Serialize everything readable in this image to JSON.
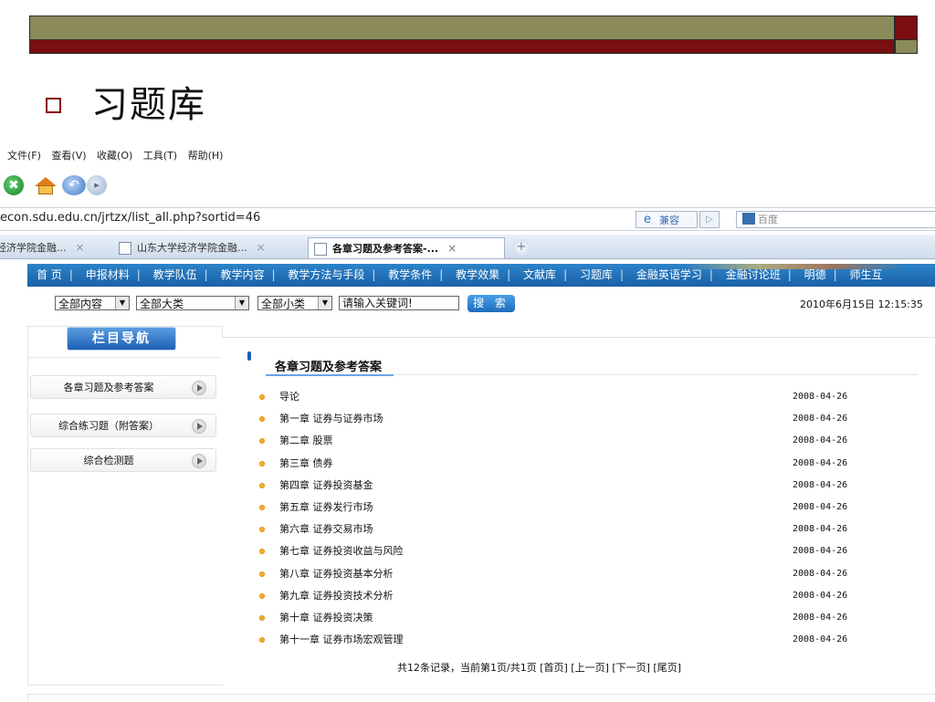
{
  "slide": {
    "title": "习题库"
  },
  "menubar": [
    "文件(F)",
    "查看(V)",
    "收藏(O)",
    "工具(T)",
    "帮助(H)"
  ],
  "address": {
    "url": "econ.sdu.edu.cn/jrtzx/list_all.php?sortid=46",
    "compat_label": "兼容",
    "search_placeholder": "百度"
  },
  "tabs": [
    {
      "label": "经济学院金融..."
    },
    {
      "label": "山东大学经济学院金融..."
    },
    {
      "label": "各章习题及参考答案-..."
    }
  ],
  "sitenav": [
    "首 页",
    "申报材料",
    "教学队伍",
    "教学内容",
    "教学方法与手段",
    "教学条件",
    "教学效果",
    "文献库",
    "习题库",
    "金融英语学习",
    "金融讨论班",
    "明德",
    "师生互"
  ],
  "filters": {
    "select1": "全部内容",
    "select2": "全部大类",
    "select3": "全部小类",
    "keyword": "请输入关键词!",
    "search_button": "搜 索",
    "datetime": "2010年6月15日 12:15:35"
  },
  "sidebar": {
    "heading": "栏目导航",
    "items": [
      "各章习题及参考答案",
      "综合练习题（附答案）",
      "综合检测题"
    ]
  },
  "main": {
    "title": "各章习题及参考答案",
    "items": [
      {
        "title": "导论",
        "date": "2008-04-26"
      },
      {
        "title": "第一章 证券与证券市场",
        "date": "2008-04-26"
      },
      {
        "title": "第二章 股票",
        "date": "2008-04-26"
      },
      {
        "title": "第三章 债券",
        "date": "2008-04-26"
      },
      {
        "title": "第四章 证券投资基金",
        "date": "2008-04-26"
      },
      {
        "title": "第五章 证券发行市场",
        "date": "2008-04-26"
      },
      {
        "title": "第六章 证券交易市场",
        "date": "2008-04-26"
      },
      {
        "title": "第七章 证券投资收益与风险",
        "date": "2008-04-26"
      },
      {
        "title": "第八章 证券投资基本分析",
        "date": "2008-04-26"
      },
      {
        "title": "第九章 证券投资技术分析",
        "date": "2008-04-26"
      },
      {
        "title": "第十章 证券投资决策",
        "date": "2008-04-26"
      },
      {
        "title": "第十一章 证券市场宏观管理",
        "date": "2008-04-26"
      }
    ],
    "pager": "共12条记录，当前第1页/共1页 [首页] [上一页] [下一页] [尾页]"
  }
}
